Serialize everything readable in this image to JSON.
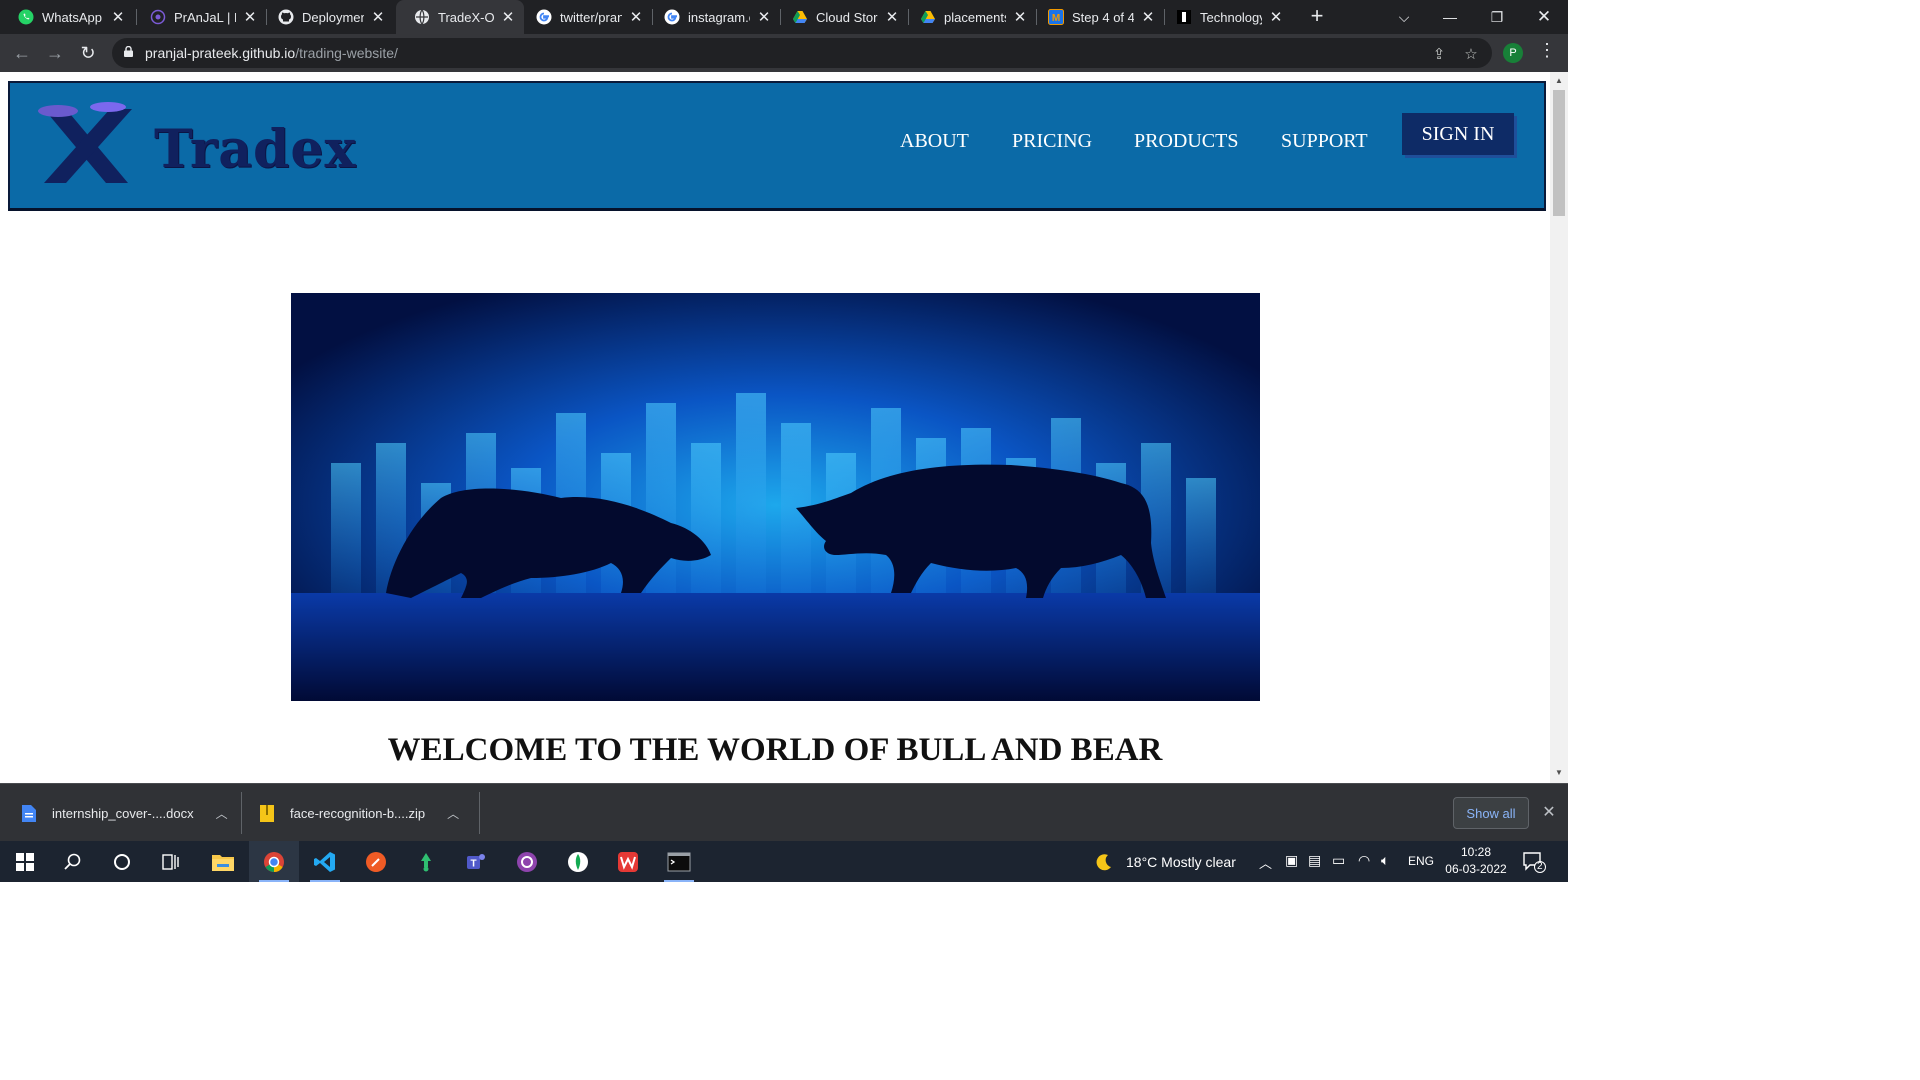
{
  "browser": {
    "tabs": [
      {
        "title": "WhatsApp",
        "icon": "whatsapp-icon",
        "active": false
      },
      {
        "title": "PrAnJaL | Po",
        "icon": "portfolio-icon",
        "active": false
      },
      {
        "title": "Deploymen",
        "icon": "github-icon",
        "active": false
      },
      {
        "title": "TradeX-Onli",
        "icon": "globe-icon",
        "active": true
      },
      {
        "title": "twitter/pran",
        "icon": "google-icon",
        "active": false
      },
      {
        "title": "instagram.c",
        "icon": "google-icon",
        "active": false
      },
      {
        "title": "Cloud Stora",
        "icon": "drive-icon",
        "active": false
      },
      {
        "title": "placements",
        "icon": "drive-icon",
        "active": false
      },
      {
        "title": "Step 4 of 4:",
        "icon": "m-icon",
        "active": false
      },
      {
        "title": "Technology",
        "icon": "dark-icon",
        "active": false
      }
    ],
    "url_host": "pranjal-prateek.github.io",
    "url_path": "/trading-website/",
    "profile_initial": "P"
  },
  "site": {
    "logo_text": "Tradex",
    "nav": [
      "ABOUT",
      "PRICING",
      "PRODUCTS",
      "SUPPORT"
    ],
    "signin_label": "SIGN IN",
    "headline": "WELCOME TO THE WORLD OF BULL AND BEAR",
    "colors": {
      "header": "#0b6aa7",
      "signin": "#0e2b66",
      "logo": "#10215e"
    }
  },
  "downloads": {
    "items": [
      "internship_cover-....docx",
      "face-recognition-b....zip"
    ],
    "show_all": "Show all"
  },
  "taskbar": {
    "weather": "18°C  Mostly clear",
    "language": "ENG",
    "time": "10:28",
    "date": "06-03-2022",
    "notifications": "2"
  }
}
